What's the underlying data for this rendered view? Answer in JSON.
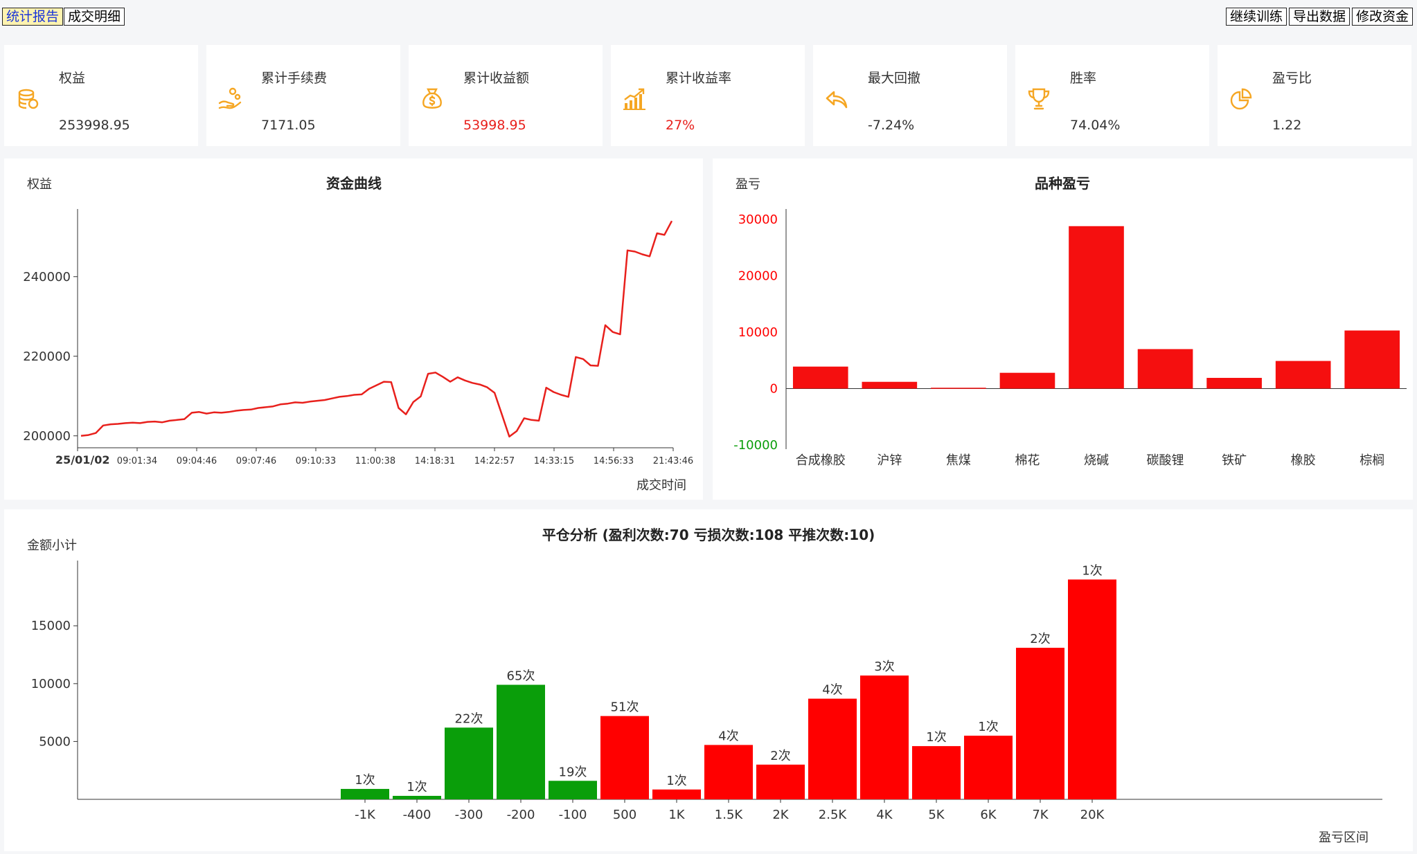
{
  "tabs": [
    {
      "label": "统计报告",
      "active": true
    },
    {
      "label": "成交明细",
      "active": false
    }
  ],
  "actions": [
    "继续训练",
    "导出数据",
    "修改资金"
  ],
  "stats": [
    {
      "label": "权益",
      "value": "253998.95",
      "icon": "coins-icon",
      "highlight": false
    },
    {
      "label": "累计手续费",
      "value": "7171.05",
      "icon": "hand-coins-icon",
      "highlight": false
    },
    {
      "label": "累计收益额",
      "value": "53998.95",
      "icon": "money-bag-icon",
      "highlight": true
    },
    {
      "label": "累计收益率",
      "value": "27%",
      "icon": "bar-growth-icon",
      "highlight": true
    },
    {
      "label": "最大回撤",
      "value": "-7.24%",
      "icon": "undo-arrow-icon",
      "highlight": false
    },
    {
      "label": "胜率",
      "value": "74.04%",
      "icon": "trophy-icon",
      "highlight": false
    },
    {
      "label": "盈亏比",
      "value": "1.22",
      "icon": "pie-icon",
      "highlight": false
    }
  ],
  "colors": {
    "accent_icon": "#f5a623",
    "profit": "#ff0000",
    "loss": "#0a9e0a",
    "equity_line": "#e8201c"
  },
  "chart_data": [
    {
      "type": "line",
      "title": "资金曲线",
      "ylabel": "权益",
      "xlabel": "成交时间",
      "ylim": [
        197000,
        257000
      ],
      "yticks": [
        200000,
        220000,
        240000
      ],
      "xticks": [
        "25/01/02",
        "09:01:34",
        "09:04:46",
        "09:07:46",
        "09:10:33",
        "11:00:38",
        "14:18:31",
        "14:22:57",
        "14:33:15",
        "14:56:33",
        "21:43:46"
      ],
      "series": [
        {
          "values": [
            200000,
            200200,
            200700,
            202600,
            202900,
            203000,
            203200,
            203300,
            203200,
            203500,
            203600,
            203400,
            203800,
            204000,
            204200,
            205800,
            206000,
            205600,
            205900,
            205800,
            206000,
            206300,
            206500,
            206600,
            207000,
            207200,
            207400,
            207900,
            208100,
            208400,
            208300,
            208600,
            208800,
            209000,
            209400,
            209800,
            210000,
            210300,
            210400,
            211800,
            212700,
            213600,
            213500,
            207000,
            205400,
            208500,
            209900,
            215600,
            215900,
            214800,
            213600,
            214700,
            213900,
            213300,
            212900,
            212200,
            210800,
            205300,
            199800,
            201200,
            204400,
            204000,
            203800,
            212100,
            211000,
            210300,
            209800,
            219800,
            219300,
            217700,
            217600,
            227800,
            226100,
            225500,
            246600,
            246300,
            245600,
            245100,
            250900,
            250500,
            253998
          ]
        }
      ]
    },
    {
      "type": "bar",
      "title": "品种盈亏",
      "ylabel": "盈亏",
      "ylim": [
        -10000,
        30000
      ],
      "yticks": [
        -10000,
        0,
        10000,
        20000,
        30000
      ],
      "categories": [
        "合成橡胶",
        "沪锌",
        "焦煤",
        "棉花",
        "烧碱",
        "碳酸锂",
        "铁矿",
        "橡胶",
        "棕榈"
      ],
      "values": [
        3900,
        1200,
        150,
        2800,
        28800,
        7000,
        1900,
        4900,
        10300
      ]
    },
    {
      "type": "bar",
      "title": "平仓分析 (盈利次数:70 亏损次数:108 平推次数:10)",
      "ylabel": "金额小计",
      "xlabel": "盈亏区间",
      "ylim": [
        0,
        19800
      ],
      "yticks": [
        5000,
        10000,
        15000
      ],
      "categories": [
        "-1K",
        "-400",
        "-300",
        "-200",
        "-100",
        "500",
        "1K",
        "1.5K",
        "2K",
        "2.5K",
        "4K",
        "5K",
        "6K",
        "7K",
        "20K"
      ],
      "values": [
        900,
        300,
        6200,
        9900,
        1600,
        7200,
        850,
        4700,
        3000,
        8700,
        10700,
        4600,
        5500,
        13100,
        19000
      ],
      "labels": [
        "1次",
        "1次",
        "22次",
        "65次",
        "19次",
        "51次",
        "1次",
        "4次",
        "2次",
        "4次",
        "3次",
        "1次",
        "1次",
        "2次",
        "1次"
      ],
      "groups": [
        "loss",
        "loss",
        "loss",
        "loss",
        "loss",
        "profit",
        "profit",
        "profit",
        "profit",
        "profit",
        "profit",
        "profit",
        "profit",
        "profit",
        "profit"
      ]
    }
  ]
}
